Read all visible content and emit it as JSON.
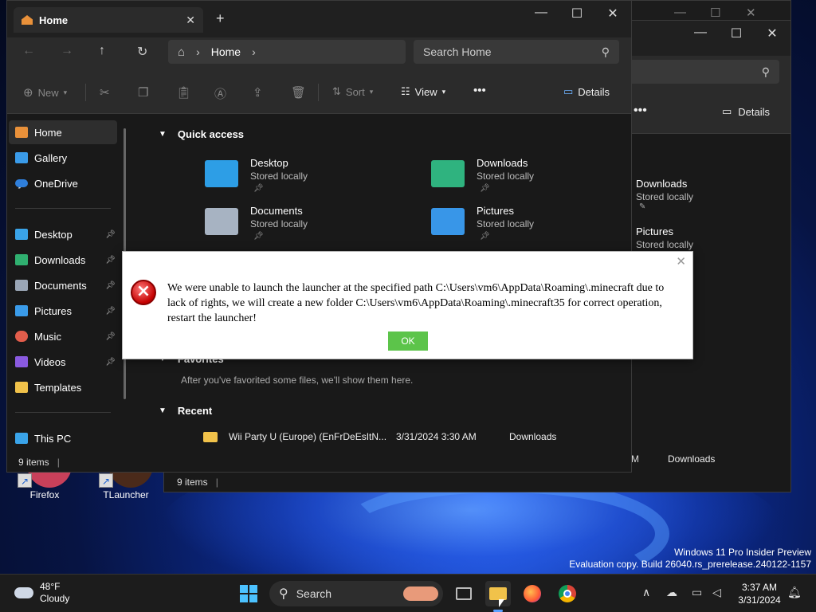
{
  "desktop": {
    "icons": [
      {
        "label": "Firefox"
      },
      {
        "label": "TLauncher"
      }
    ],
    "watermark": {
      "line1": "Windows 11 Pro Insider Preview",
      "line2": "Evaluation copy. Build 26040.rs_prerelease.240122-1157"
    }
  },
  "back_window": {
    "search_fragment": "ome",
    "details_label": "Details",
    "items": [
      {
        "name": "Downloads",
        "sub": "Stored locally"
      },
      {
        "name": "Pictures",
        "sub": "Stored locally"
      }
    ],
    "recent_location_fragment": "M",
    "recent_location": "Downloads",
    "status": "9 items"
  },
  "explorer": {
    "tab_title": "Home",
    "new_tab_glyph": "+",
    "address": {
      "root": "Home"
    },
    "search_placeholder": "Search Home",
    "toolbar": {
      "new_label": "New",
      "sort_label": "Sort",
      "view_label": "View",
      "more_label": "•••",
      "details_label": "Details"
    },
    "sidebar": {
      "items": [
        {
          "label": "Home",
          "color": "#e9913a"
        },
        {
          "label": "Gallery",
          "color": "#3a9be9"
        },
        {
          "label": "OneDrive",
          "color": "#2f7fdb"
        },
        {
          "label": "Desktop",
          "color": "#3aa4e9"
        },
        {
          "label": "Downloads",
          "color": "#30b070"
        },
        {
          "label": "Documents",
          "color": "#9aa6b6"
        },
        {
          "label": "Pictures",
          "color": "#3a9be9"
        },
        {
          "label": "Music",
          "color": "#e35d4b"
        },
        {
          "label": "Videos",
          "color": "#8a5ae0"
        },
        {
          "label": "Templates",
          "color": "#f1c24a"
        },
        {
          "label": "This PC",
          "color": "#3aa4e9"
        }
      ]
    },
    "quick_access": {
      "heading": "Quick access",
      "items": [
        {
          "name": "Desktop",
          "sub": "Stored locally",
          "color": "#2d9ee6"
        },
        {
          "name": "Downloads",
          "sub": "Stored locally",
          "color": "#2fb37f"
        },
        {
          "name": "Documents",
          "sub": "Stored locally",
          "color": "#a7b3c2"
        },
        {
          "name": "Pictures",
          "sub": "Stored locally",
          "color": "#3896e8"
        }
      ]
    },
    "favorites": {
      "heading": "Favorites",
      "empty_message": "After you've favorited some files, we'll show them here."
    },
    "recent": {
      "heading": "Recent",
      "rows": [
        {
          "name": "Wii Party U (Europe) (EnFrDeEsItN...",
          "date": "3/31/2024 3:30 AM",
          "location": "Downloads"
        }
      ]
    },
    "status": "9 items"
  },
  "dialog": {
    "message": "We were unable to launch the launcher at the specified path C:\\Users\\vm6\\AppData\\Roaming\\.minecraft due to lack of rights, we will create a new folder C:\\Users\\vm6\\AppData\\Roaming\\.minecraft35 for correct operation, restart the launcher!",
    "ok_label": "OK",
    "close_glyph": "✕"
  },
  "taskbar": {
    "weather_temp": "48°F",
    "weather_desc": "Cloudy",
    "search_label": "Search",
    "time": "3:37 AM",
    "date": "3/31/2024"
  }
}
